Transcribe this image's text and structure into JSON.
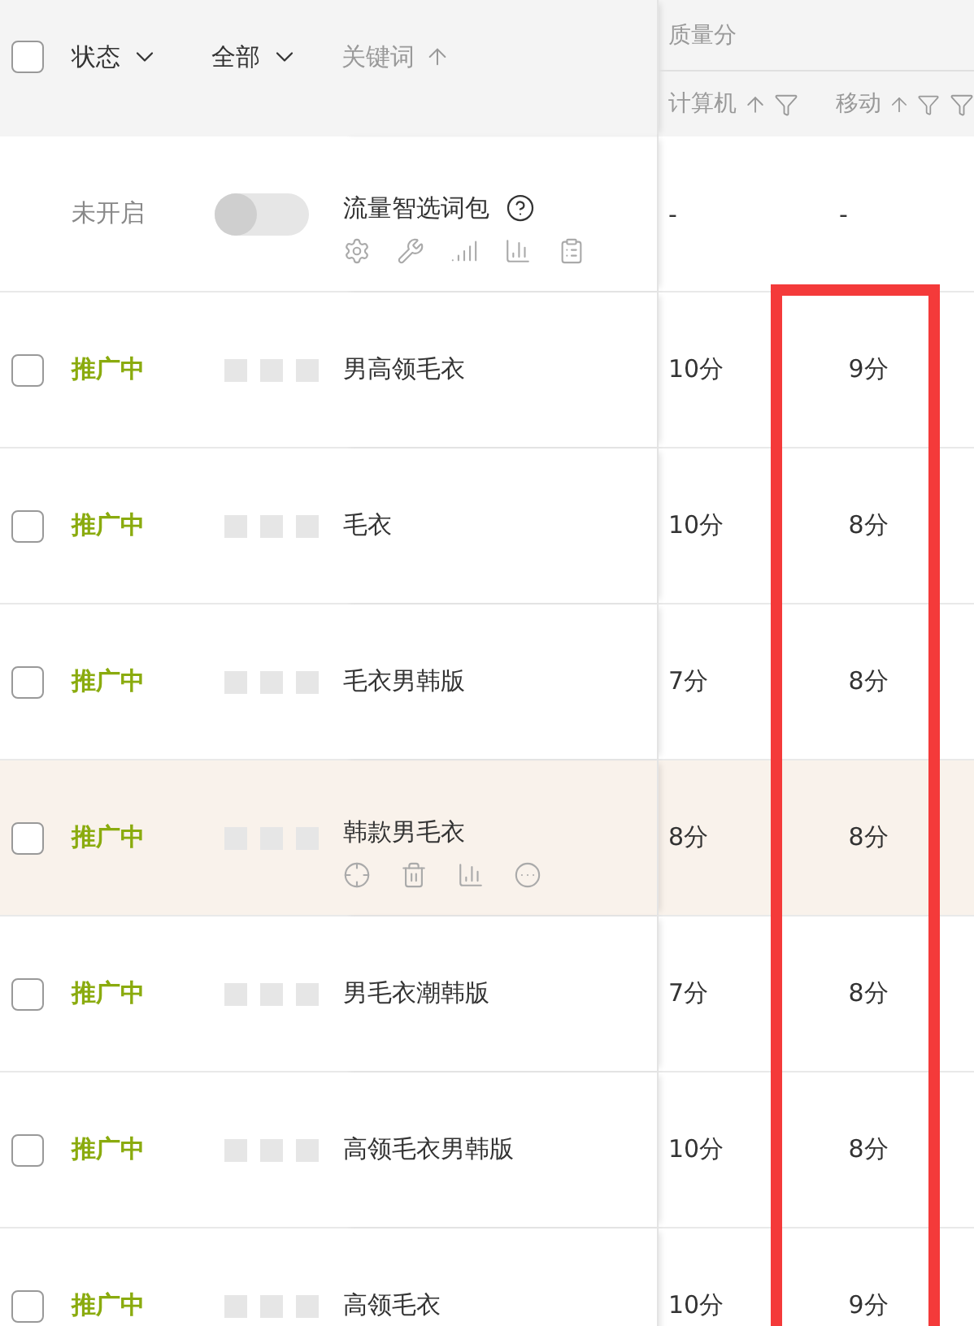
{
  "header": {
    "select_all": {
      "checked": false
    },
    "columns": [
      {
        "label": "状态",
        "kind": "dropdown"
      },
      {
        "label": "全部",
        "kind": "dropdown"
      },
      {
        "label": "关键词",
        "kind": "sort"
      }
    ],
    "group": {
      "label": "质量分",
      "columns": [
        {
          "label": "计算机",
          "highlighted": false
        },
        {
          "label": "移动",
          "highlighted": true
        }
      ]
    }
  },
  "package_row": {
    "status": "未开启",
    "switch": {
      "on": false
    },
    "name": "流量智选词包",
    "pc": "-",
    "mobile": "-"
  },
  "rows": [
    {
      "checked": false,
      "status": "推广中",
      "keyword": "男高领毛衣",
      "pc": "10分",
      "mobile": "9分",
      "hovered": false
    },
    {
      "checked": false,
      "status": "推广中",
      "keyword": "毛衣",
      "pc": "10分",
      "mobile": "8分",
      "hovered": false
    },
    {
      "checked": false,
      "status": "推广中",
      "keyword": "毛衣男韩版",
      "pc": "7分",
      "mobile": "8分",
      "hovered": false
    },
    {
      "checked": false,
      "status": "推广中",
      "keyword": "韩款男毛衣",
      "pc": "8分",
      "mobile": "8分",
      "hovered": true
    },
    {
      "checked": false,
      "status": "推广中",
      "keyword": "男毛衣潮韩版",
      "pc": "7分",
      "mobile": "8分",
      "hovered": false
    },
    {
      "checked": false,
      "status": "推广中",
      "keyword": "高领毛衣男韩版",
      "pc": "10分",
      "mobile": "8分",
      "hovered": false
    },
    {
      "checked": false,
      "status": "推广中",
      "keyword": "高领毛衣",
      "pc": "10分",
      "mobile": "9分",
      "hovered": false
    }
  ]
}
